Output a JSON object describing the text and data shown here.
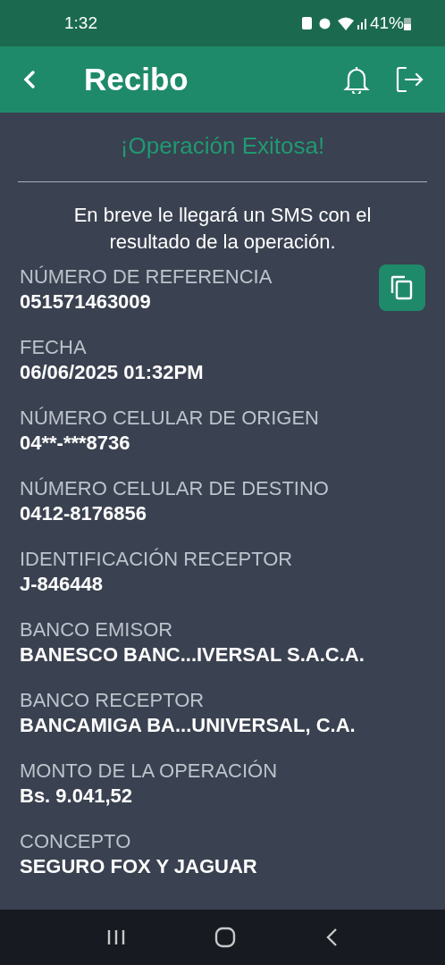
{
  "status_bar": {
    "time": "1:32",
    "battery": "41%"
  },
  "header": {
    "title": "Recibo"
  },
  "success_title": "¡Operación Exitosa!",
  "message": "En breve le llegará un SMS con el resultado de la operación.",
  "fields": [
    {
      "label": "NÚMERO DE REFERENCIA",
      "value": "051571463009",
      "copyable": true
    },
    {
      "label": "FECHA",
      "value": "06/06/2025 01:32PM",
      "copyable": false
    },
    {
      "label": "NÚMERO CELULAR DE ORIGEN",
      "value": "04**-***8736",
      "copyable": false
    },
    {
      "label": "NÚMERO CELULAR DE DESTINO",
      "value": "0412-8176856",
      "copyable": false
    },
    {
      "label": "IDENTIFICACIÓN RECEPTOR",
      "value": "J-846448",
      "copyable": false
    },
    {
      "label": "BANCO EMISOR",
      "value": "BANESCO BANC...IVERSAL S.A.C.A.",
      "copyable": false
    },
    {
      "label": "BANCO RECEPTOR",
      "value": "BANCAMIGA BA...UNIVERSAL, C.A.",
      "copyable": false
    },
    {
      "label": "MONTO DE LA OPERACIÓN",
      "value": "Bs. 9.041,52",
      "copyable": false
    },
    {
      "label": "CONCEPTO",
      "value": "SEGURO FOX Y JAGUAR",
      "copyable": false
    }
  ]
}
